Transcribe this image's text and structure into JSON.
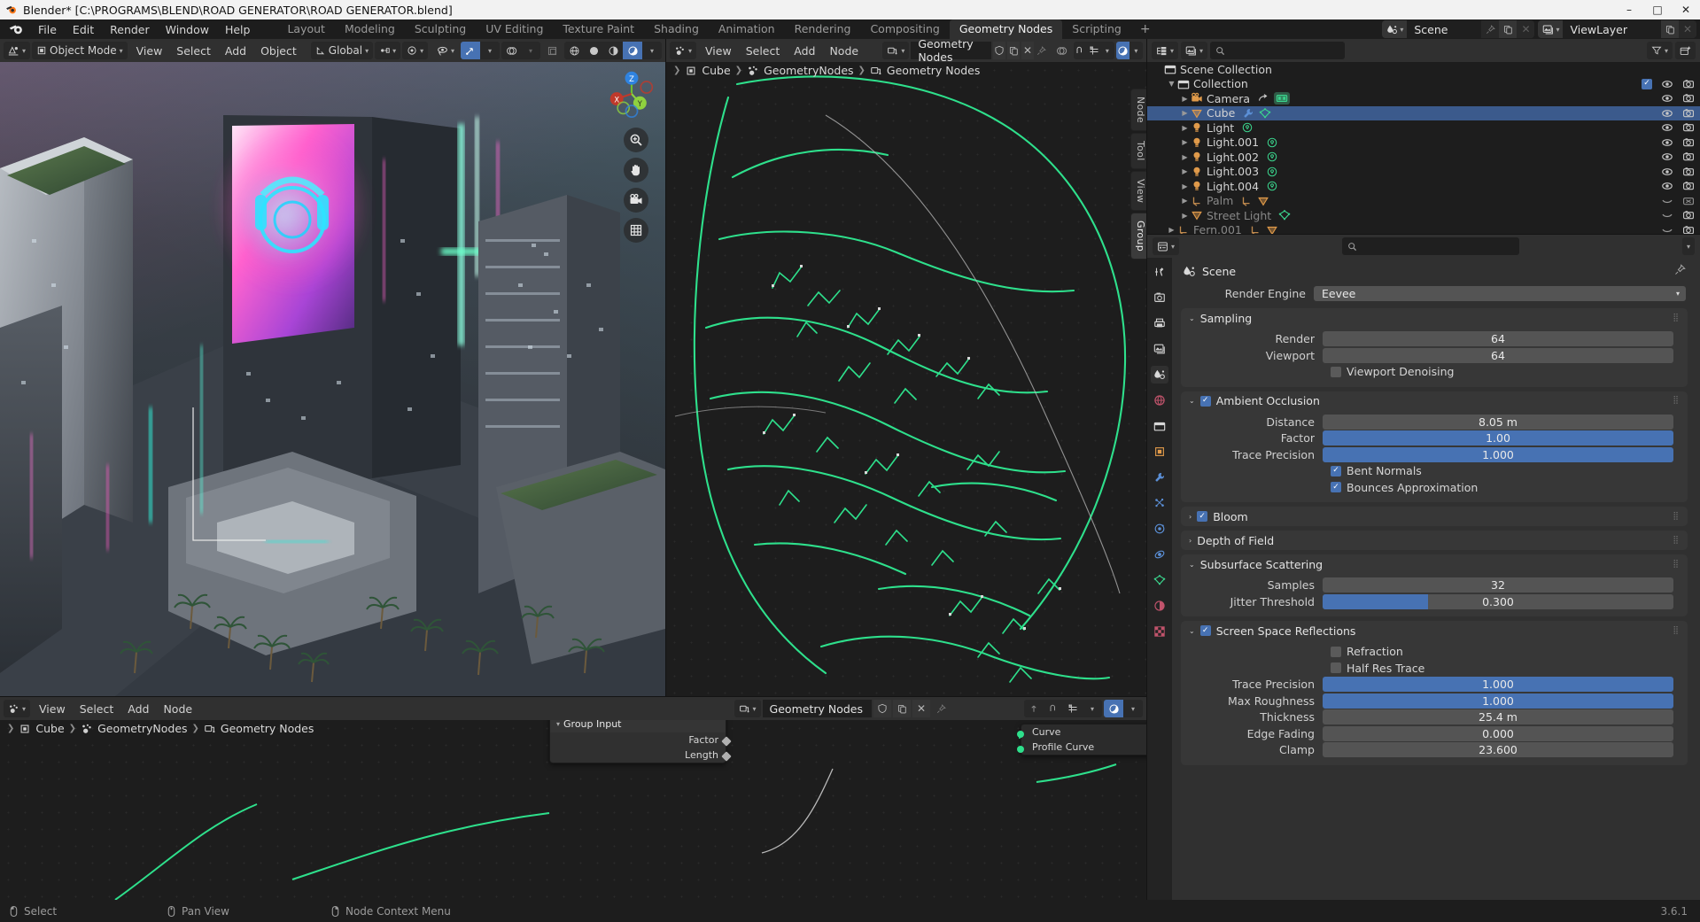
{
  "window": {
    "title": "Blender* [C:\\PROGRAMS\\BLEND\\ROAD GENERATOR\\ROAD GENERATOR.blend]",
    "minimize": "–",
    "maximize": "□",
    "close": "✕"
  },
  "topbar": {
    "menus": [
      "File",
      "Edit",
      "Render",
      "Window",
      "Help"
    ],
    "workspaces": [
      {
        "label": "Layout",
        "active": false
      },
      {
        "label": "Modeling",
        "active": false
      },
      {
        "label": "Sculpting",
        "active": false
      },
      {
        "label": "UV Editing",
        "active": false
      },
      {
        "label": "Texture Paint",
        "active": false
      },
      {
        "label": "Shading",
        "active": false
      },
      {
        "label": "Animation",
        "active": false
      },
      {
        "label": "Rendering",
        "active": false
      },
      {
        "label": "Compositing",
        "active": false
      },
      {
        "label": "Geometry Nodes",
        "active": true
      },
      {
        "label": "Scripting",
        "active": false
      }
    ],
    "add_workspace": "+",
    "scene_name": "Scene",
    "viewlayer_name": "ViewLayer"
  },
  "viewport3d": {
    "mode": "Object Mode",
    "menus": [
      "View",
      "Select",
      "Add",
      "Object"
    ],
    "transform_orientation": "Global",
    "gizmo_axes": [
      "X",
      "Y",
      "Z"
    ],
    "nav_buttons": [
      "zoom-icon",
      "hand-icon",
      "camera-icon",
      "grid-icon"
    ],
    "side_tabs": []
  },
  "node_editor": {
    "menus": [
      "View",
      "Select",
      "Add",
      "Node"
    ],
    "tree_name": "Geometry Nodes",
    "breadcrumb": [
      "Cube",
      "GeometryNodes",
      "Geometry Nodes"
    ],
    "side_tabs": [
      "Node",
      "Tool",
      "View",
      "Group"
    ]
  },
  "bottom_node_editor": {
    "menus": [
      "View",
      "Select",
      "Add",
      "Node"
    ],
    "tree_name": "Geometry Nodes",
    "breadcrumb": [
      "Cube",
      "GeometryNodes",
      "Geometry Nodes"
    ],
    "nodes": [
      {
        "title": "Group Input",
        "outputs": [
          "Factor",
          "Length"
        ]
      },
      {
        "title": "",
        "outputs": [
          "Curve",
          "Profile Curve"
        ]
      }
    ]
  },
  "outliner": {
    "search_placeholder": "",
    "rows": [
      {
        "name": "Scene Collection",
        "depth": 0,
        "icon": "collection-icon",
        "disclosure": "",
        "dim": false,
        "selected": false,
        "checkbox": false,
        "eye": false,
        "camera": false
      },
      {
        "name": "Collection",
        "depth": 1,
        "icon": "collection-icon",
        "disclosure": "▼",
        "dim": false,
        "selected": false,
        "checkbox": true,
        "eye": true,
        "camera": true
      },
      {
        "name": "Camera",
        "depth": 2,
        "icon": "camera-obj-icon",
        "disclosure": "▶",
        "dim": false,
        "selected": false,
        "checkbox": false,
        "eye": true,
        "camera": true
      },
      {
        "name": "Cube",
        "depth": 2,
        "icon": "mesh-icon",
        "disclosure": "▶",
        "dim": false,
        "selected": true,
        "checkbox": false,
        "eye": true,
        "camera": true
      },
      {
        "name": "Light",
        "depth": 2,
        "icon": "light-icon",
        "disclosure": "▶",
        "dim": false,
        "selected": false,
        "checkbox": false,
        "eye": true,
        "camera": true
      },
      {
        "name": "Light.001",
        "depth": 2,
        "icon": "light-icon",
        "disclosure": "▶",
        "dim": false,
        "selected": false,
        "checkbox": false,
        "eye": true,
        "camera": true
      },
      {
        "name": "Light.002",
        "depth": 2,
        "icon": "light-icon",
        "disclosure": "▶",
        "dim": false,
        "selected": false,
        "checkbox": false,
        "eye": true,
        "camera": true
      },
      {
        "name": "Light.003",
        "depth": 2,
        "icon": "light-icon",
        "disclosure": "▶",
        "dim": false,
        "selected": false,
        "checkbox": false,
        "eye": true,
        "camera": true
      },
      {
        "name": "Light.004",
        "depth": 2,
        "icon": "light-icon",
        "disclosure": "▶",
        "dim": false,
        "selected": false,
        "checkbox": false,
        "eye": true,
        "camera": true
      },
      {
        "name": "Palm",
        "depth": 2,
        "icon": "empty-icon",
        "disclosure": "▶",
        "dim": true,
        "selected": false,
        "checkbox": false,
        "eye": false,
        "camera": true
      },
      {
        "name": "Street Light",
        "depth": 2,
        "icon": "mesh-icon",
        "disclosure": "▶",
        "dim": true,
        "selected": false,
        "checkbox": false,
        "eye": false,
        "camera": true
      },
      {
        "name": "Fern.001",
        "depth": 1,
        "icon": "empty-icon",
        "disclosure": "▶",
        "dim": true,
        "selected": false,
        "checkbox": false,
        "eye": false,
        "camera": true
      }
    ]
  },
  "properties": {
    "search_placeholder": "",
    "context_title": "Scene",
    "render_engine_label": "Render Engine",
    "render_engine_value": "Eevee",
    "panels": [
      {
        "id": "sampling",
        "title": "Sampling",
        "expanded": true,
        "has_checkbox": false,
        "checked": false,
        "rows": [
          {
            "type": "value",
            "label": "Render",
            "value": "64",
            "style": "plain"
          },
          {
            "type": "value",
            "label": "Viewport",
            "value": "64",
            "style": "plain"
          },
          {
            "type": "checkbox",
            "label": "Viewport Denoising",
            "checked": false
          }
        ]
      },
      {
        "id": "ambient-occlusion",
        "title": "Ambient Occlusion",
        "expanded": true,
        "has_checkbox": true,
        "checked": true,
        "rows": [
          {
            "type": "value",
            "label": "Distance",
            "value": "8.05 m",
            "style": "plain"
          },
          {
            "type": "value",
            "label": "Factor",
            "value": "1.00",
            "style": "blue"
          },
          {
            "type": "value",
            "label": "Trace Precision",
            "value": "1.000",
            "style": "blue"
          },
          {
            "type": "checkbox",
            "label": "Bent Normals",
            "checked": true
          },
          {
            "type": "checkbox",
            "label": "Bounces Approximation",
            "checked": true
          }
        ]
      },
      {
        "id": "bloom",
        "title": "Bloom",
        "expanded": false,
        "has_checkbox": true,
        "checked": true,
        "rows": []
      },
      {
        "id": "depth-of-field",
        "title": "Depth of Field",
        "expanded": false,
        "has_checkbox": false,
        "checked": false,
        "rows": []
      },
      {
        "id": "subsurface-scattering",
        "title": "Subsurface Scattering",
        "expanded": true,
        "has_checkbox": false,
        "checked": false,
        "rows": [
          {
            "type": "value",
            "label": "Samples",
            "value": "32",
            "style": "plain"
          },
          {
            "type": "value",
            "label": "Jitter Threshold",
            "value": "0.300",
            "style": "partial",
            "fill": 30
          }
        ]
      },
      {
        "id": "screen-space-reflections",
        "title": "Screen Space Reflections",
        "expanded": true,
        "has_checkbox": true,
        "checked": true,
        "rows": [
          {
            "type": "checkbox",
            "label": "Refraction",
            "checked": false
          },
          {
            "type": "checkbox",
            "label": "Half Res Trace",
            "checked": false
          },
          {
            "type": "value",
            "label": "Trace Precision",
            "value": "1.000",
            "style": "blue"
          },
          {
            "type": "value",
            "label": "Max Roughness",
            "value": "1.000",
            "style": "blue"
          },
          {
            "type": "value",
            "label": "Thickness",
            "value": "25.4 m",
            "style": "plain"
          },
          {
            "type": "value",
            "label": "Edge Fading",
            "value": "0.000",
            "style": "plain"
          },
          {
            "type": "value",
            "label": "Clamp",
            "value": "23.600",
            "style": "plain"
          }
        ]
      }
    ],
    "tab_icons": [
      "tool-icon",
      "render-icon",
      "output-icon",
      "viewlayer-icon",
      "scene-icon",
      "world-icon",
      "collection-icon",
      "object-icon",
      "modifier-icon",
      "particles-icon",
      "physics-icon",
      "constraint-icon",
      "data-icon",
      "material-icon",
      "texture-icon"
    ],
    "active_tab": "scene-icon"
  },
  "statusbar": {
    "items": [
      {
        "icon": "mouse-left-icon",
        "label": "Select"
      },
      {
        "icon": "mouse-middle-icon",
        "label": "Pan View"
      },
      {
        "icon": "mouse-right-icon",
        "label": "Node Context Menu"
      }
    ],
    "version": "3.6.1"
  },
  "colors": {
    "accent_blue": "#4772b3",
    "selection_blue": "#3b5a8c",
    "node_green": "#2ee08c",
    "panel_bg": "#303030",
    "editor_bg": "#1d1d1d",
    "header_bg": "#303030"
  }
}
